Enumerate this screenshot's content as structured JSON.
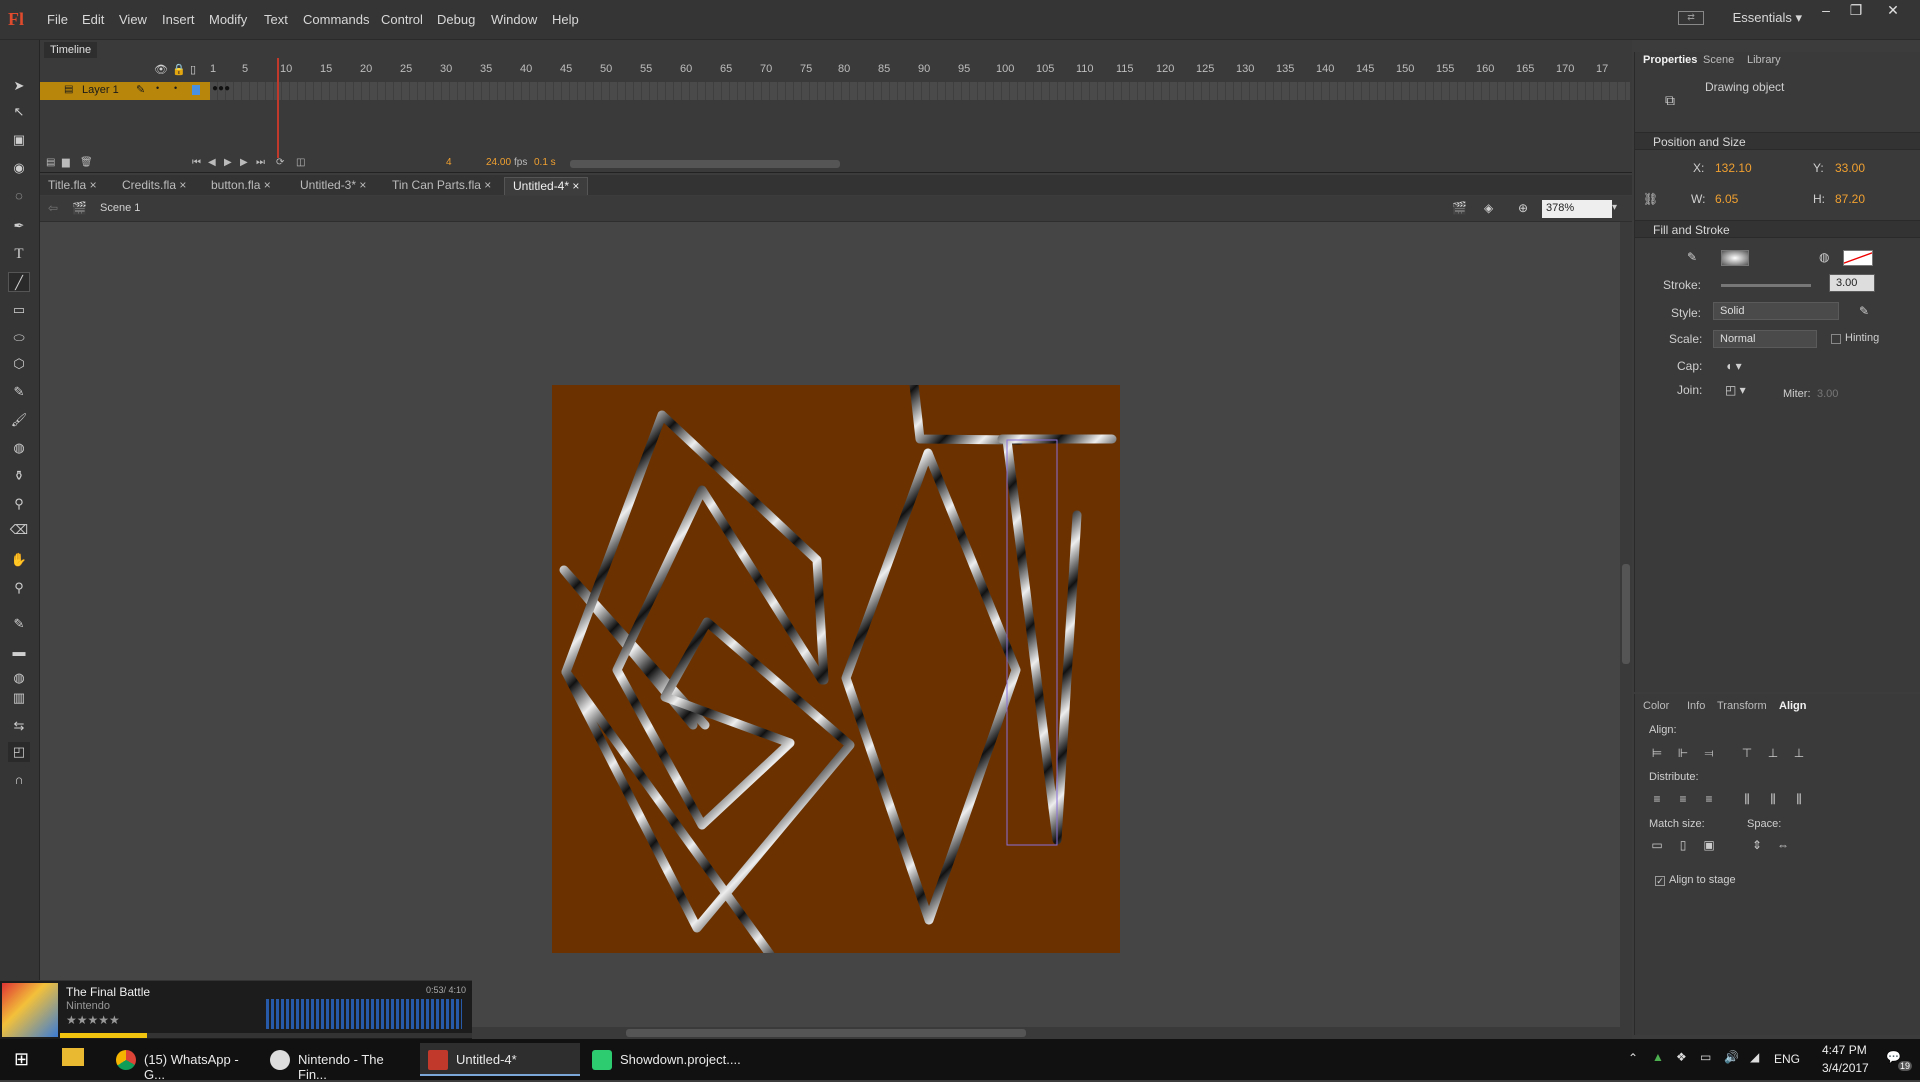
{
  "menubar": {
    "logo": "Fl",
    "items": [
      "File",
      "Edit",
      "View",
      "Insert",
      "Modify",
      "Text",
      "Commands",
      "Control",
      "Debug",
      "Window",
      "Help"
    ],
    "workspace": "Essentials"
  },
  "timeline": {
    "tab": "Timeline",
    "ticks": [
      "1",
      "5",
      "10",
      "15",
      "20",
      "25",
      "30",
      "35",
      "40",
      "45",
      "50",
      "55",
      "60",
      "65",
      "70",
      "75",
      "80",
      "85",
      "90",
      "95",
      "100",
      "105",
      "110",
      "115",
      "120",
      "125",
      "130",
      "135",
      "140",
      "145",
      "150",
      "155",
      "160",
      "165",
      "170",
      "17"
    ],
    "layer_name": "Layer 1",
    "current_frame": "4",
    "fps": "24.00",
    "fps_unit": "fps",
    "time": "0.1 s"
  },
  "doc_tabs": [
    "Title.fla",
    "Credits.fla",
    "button.fla",
    "Untitled-3*",
    "Tin Can Parts.fla",
    "Untitled-4*"
  ],
  "scene": {
    "name": "Scene 1",
    "zoom": "378%"
  },
  "properties": {
    "tabs": [
      "Properties",
      "Scene",
      "Library"
    ],
    "object_type": "Drawing object",
    "position_section": "Position and Size",
    "x_label": "X:",
    "x": "132.10",
    "y_label": "Y:",
    "y": "33.00",
    "w_label": "W:",
    "w": "6.05",
    "h_label": "H:",
    "h": "87.20",
    "fill_section": "Fill and Stroke",
    "stroke_label": "Stroke:",
    "stroke": "3.00",
    "style_label": "Style:",
    "style": "Solid",
    "scale_label": "Scale:",
    "scale": "Normal",
    "hinting": "Hinting",
    "cap_label": "Cap:",
    "join_label": "Join:",
    "miter_label": "Miter:",
    "miter": "3.00"
  },
  "align": {
    "tabs": [
      "Color",
      "Info",
      "Transform",
      "Align"
    ],
    "align_label": "Align:",
    "distribute_label": "Distribute:",
    "match_label": "Match size:",
    "space_label": "Space:",
    "align_to_stage": "Align to stage"
  },
  "player": {
    "title": "The Final Battle",
    "artist": "Nintendo",
    "time": "0:53/ 4:10",
    "rating": "★★★★★",
    "progress": 0.21
  },
  "taskbar": {
    "items": [
      "(15) WhatsApp - G...",
      "Nintendo - The Fin...",
      "Untitled-4*",
      "Showdown.project...."
    ],
    "lang": "ENG",
    "time": "4:47 PM",
    "date": "3/4/2017",
    "notif": "19"
  },
  "colors": {
    "stage": "#6b3200",
    "accent": "#f0a030",
    "layer": "#b8860b",
    "playhead": "#c0392b"
  }
}
